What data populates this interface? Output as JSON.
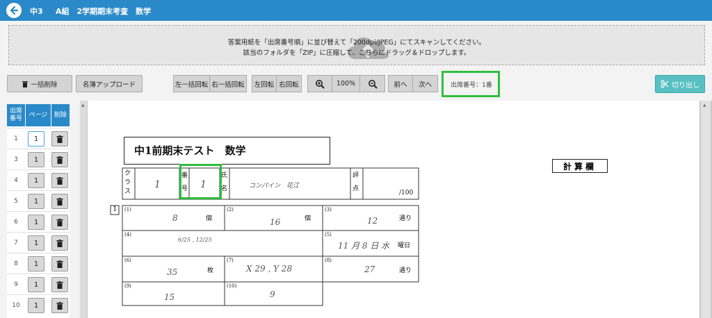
{
  "header": {
    "grade": "中3",
    "title": "A組　2学期期末考査　数学"
  },
  "dropzone": {
    "line1": "答案用紙を「出席番号順」に並び替えて「200dpi/JPEG」にてスキャンしてください。",
    "line2": "該当のフォルダを「ZIP」に圧縮して、こちらにドラッグ＆ドロップします。"
  },
  "toolbar": {
    "bulk_delete": "一括削除",
    "roster_upload": "名簿アップロード",
    "rotate_left_all": "左一括回転",
    "rotate_right_all": "右一括回転",
    "rotate_left": "左回転",
    "rotate_right": "右回転",
    "zoom": "100%",
    "prev": "前へ",
    "next": "次へ",
    "seat_number": "出席番号：1番",
    "cut_out": "切り出し"
  },
  "pages_table": {
    "headers": [
      "出席\n番号",
      "ページ",
      "削除"
    ],
    "rows": [
      {
        "no": "1",
        "page": "1",
        "selected": true
      },
      {
        "no": "3",
        "page": "1"
      },
      {
        "no": "4",
        "page": "1"
      },
      {
        "no": "5",
        "page": "1"
      },
      {
        "no": "6",
        "page": "1"
      },
      {
        "no": "7",
        "page": "1"
      },
      {
        "no": "8",
        "page": "1"
      },
      {
        "no": "9",
        "page": "1"
      },
      {
        "no": "10",
        "page": "1"
      }
    ]
  },
  "answer_sheet": {
    "title": "中1前期末テスト　数学",
    "calc_area": "計算欄",
    "labels": {
      "class": "ク\nラ\nス",
      "number": "番\n号",
      "name": "氏\n名",
      "score": "評\n点",
      "out_of": "/100",
      "section": "1"
    },
    "handwritten": {
      "class": "1",
      "number": "1",
      "name": "コンパイン　花江"
    },
    "cells": [
      {
        "n": "(1)",
        "ans": "8",
        "unit": "個"
      },
      {
        "n": "(2)",
        "ans": "16",
        "unit": "個"
      },
      {
        "n": "(3)",
        "ans": "12",
        "unit": "通り"
      },
      {
        "n": "(4)",
        "ans": "6/25 , 12/25",
        "unit": ""
      },
      {
        "n": "(5)",
        "ans": "11 月 8 日 水",
        "unit": "曜日"
      },
      {
        "n": "(6)",
        "ans": "35",
        "unit": "枚"
      },
      {
        "n": "(7)",
        "ans": "X 29 , Y 28",
        "unit": ""
      },
      {
        "n": "(8)",
        "ans": "27",
        "unit": "通り"
      },
      {
        "n": "(9)",
        "ans": "15",
        "unit": ""
      },
      {
        "n": "(10)",
        "ans": "9",
        "unit": ""
      }
    ]
  },
  "colors": {
    "header": "#2a89c8",
    "highlight": "#2fbe3c",
    "cut_button": "#57c0c2"
  }
}
